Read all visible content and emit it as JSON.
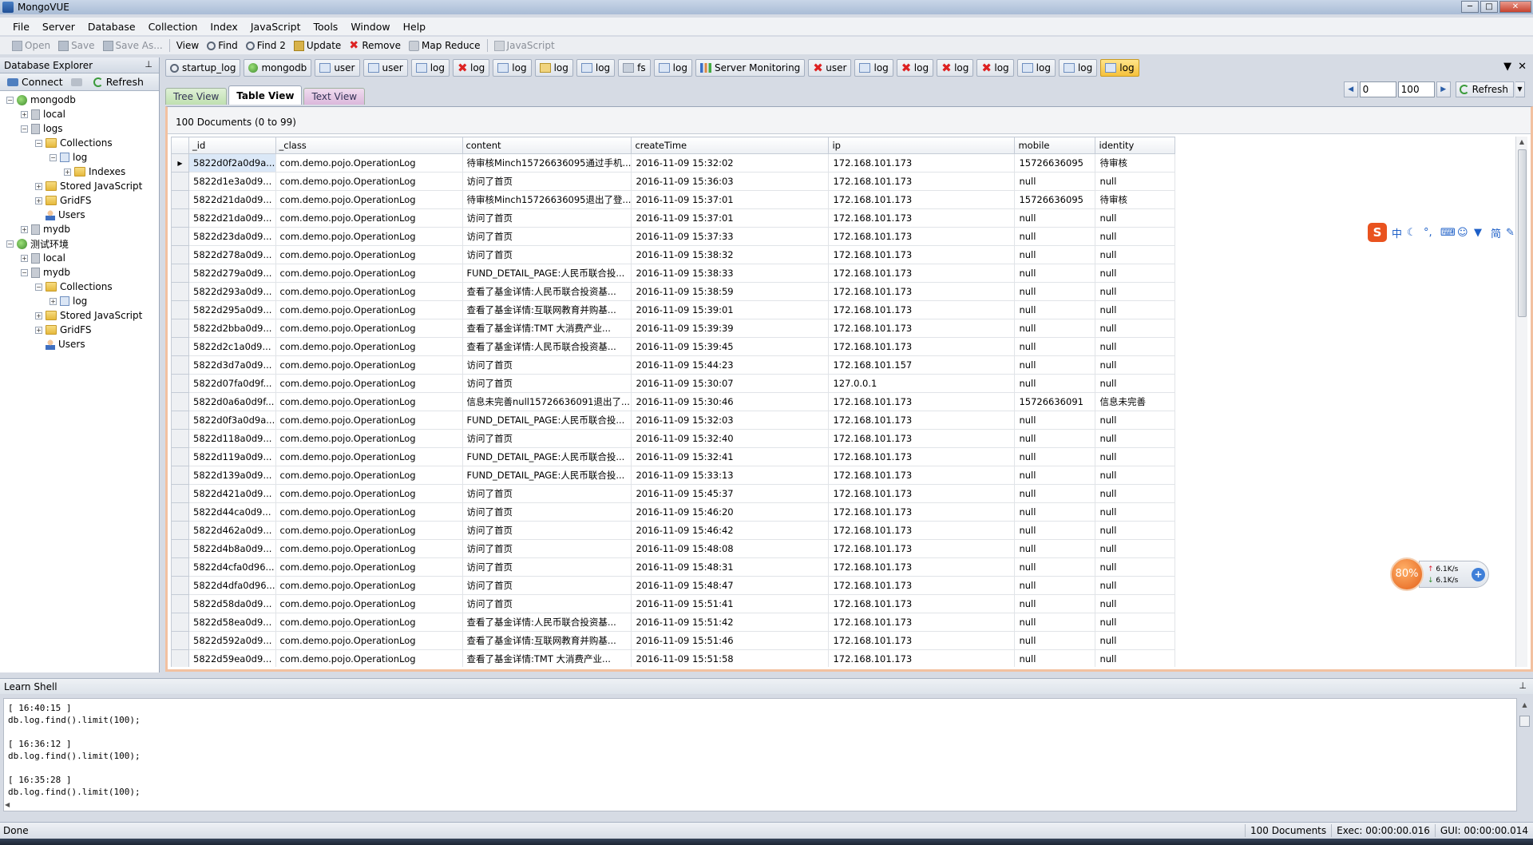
{
  "window": {
    "title": "MongoVUE",
    "min_label": "─",
    "max_label": "□",
    "close_label": "✕"
  },
  "menu": [
    "File",
    "Server",
    "Database",
    "Collection",
    "Index",
    "JavaScript",
    "Tools",
    "Window",
    "Help"
  ],
  "toolbar": {
    "open": "Open",
    "save": "Save",
    "save_as": "Save As...",
    "view": "View",
    "find": "Find",
    "find2": "Find 2",
    "update": "Update",
    "remove": "Remove",
    "map_reduce": "Map Reduce",
    "javascript": "JavaScript"
  },
  "explorer": {
    "title": "Database Explorer",
    "pin": "⊥",
    "connect": "Connect",
    "refresh": "Refresh",
    "tree": [
      {
        "label": "mongodb",
        "level": 0,
        "toggle": "−",
        "icon": "server-icon"
      },
      {
        "label": "local",
        "level": 1,
        "toggle": "+",
        "icon": "database-icon"
      },
      {
        "label": "logs",
        "level": 1,
        "toggle": "−",
        "icon": "database-icon"
      },
      {
        "label": "Collections",
        "level": 2,
        "toggle": "−",
        "icon": "folder-icon"
      },
      {
        "label": "log",
        "level": 3,
        "toggle": "−",
        "icon": "collection-icon"
      },
      {
        "label": "Indexes",
        "level": 4,
        "toggle": "+",
        "icon": "folder-icon"
      },
      {
        "label": "Stored JavaScript",
        "level": 2,
        "toggle": "+",
        "icon": "folder-icon"
      },
      {
        "label": "GridFS",
        "level": 2,
        "toggle": "+",
        "icon": "folder-icon"
      },
      {
        "label": "Users",
        "level": 2,
        "toggle": "",
        "icon": "user-icon"
      },
      {
        "label": "mydb",
        "level": 1,
        "toggle": "+",
        "icon": "database-icon"
      },
      {
        "label": "测试环境",
        "level": 0,
        "toggle": "−",
        "icon": "server-icon"
      },
      {
        "label": "local",
        "level": 1,
        "toggle": "+",
        "icon": "database-icon"
      },
      {
        "label": "mydb",
        "level": 1,
        "toggle": "−",
        "icon": "database-icon"
      },
      {
        "label": "Collections",
        "level": 2,
        "toggle": "−",
        "icon": "folder-icon"
      },
      {
        "label": "log",
        "level": 3,
        "toggle": "+",
        "icon": "collection-icon"
      },
      {
        "label": "Stored JavaScript",
        "level": 2,
        "toggle": "+",
        "icon": "folder-icon"
      },
      {
        "label": "GridFS",
        "level": 2,
        "toggle": "+",
        "icon": "folder-icon"
      },
      {
        "label": "Users",
        "level": 2,
        "toggle": "",
        "icon": "user-icon"
      }
    ]
  },
  "doc_tabs": [
    {
      "label": "startup_log",
      "icon": "find"
    },
    {
      "label": "mongodb",
      "icon": "db"
    },
    {
      "label": "user",
      "icon": "coll"
    },
    {
      "label": "user",
      "icon": "coll"
    },
    {
      "label": "log",
      "icon": "coll"
    },
    {
      "label": "log",
      "icon": "x"
    },
    {
      "label": "log",
      "icon": "coll"
    },
    {
      "label": "log",
      "icon": "edit"
    },
    {
      "label": "log",
      "icon": "coll"
    },
    {
      "label": "fs",
      "icon": "fs"
    },
    {
      "label": "log",
      "icon": "coll"
    },
    {
      "label": "Server Monitoring",
      "icon": "chart"
    },
    {
      "label": "user",
      "icon": "x"
    },
    {
      "label": "log",
      "icon": "coll"
    },
    {
      "label": "log",
      "icon": "x"
    },
    {
      "label": "log",
      "icon": "x"
    },
    {
      "label": "log",
      "icon": "x"
    },
    {
      "label": "log",
      "icon": "coll"
    },
    {
      "label": "log",
      "icon": "coll"
    },
    {
      "label": "log",
      "icon": "coll",
      "active": true
    }
  ],
  "tabs_ctrl": {
    "dropdown": "▼",
    "close": "✕"
  },
  "views": {
    "tree": "Tree View",
    "table": "Table View",
    "text": "Text View"
  },
  "pager": {
    "skip": "0",
    "limit": "100",
    "refresh": "Refresh",
    "prev": "◀",
    "next": "▶",
    "drop": "▼"
  },
  "results": {
    "count_label": "100 Documents (0 to 99)",
    "columns": [
      "_id",
      "_class",
      "content",
      "createTime",
      "ip",
      "mobile",
      "identity"
    ],
    "rows": [
      [
        "5822d0f2a0d9a...",
        "com.demo.pojo.OperationLog",
        "待审核Minch15726636095通过手机...",
        "2016-11-09 15:32:02",
        "172.168.101.173",
        "15726636095",
        "待审核"
      ],
      [
        "5822d1e3a0d9...",
        "com.demo.pojo.OperationLog",
        "访问了首页",
        "2016-11-09 15:36:03",
        "172.168.101.173",
        "null",
        "null"
      ],
      [
        "5822d21da0d9...",
        "com.demo.pojo.OperationLog",
        "待审核Minch15726636095退出了登...",
        "2016-11-09 15:37:01",
        "172.168.101.173",
        "15726636095",
        "待审核"
      ],
      [
        "5822d21da0d9...",
        "com.demo.pojo.OperationLog",
        "访问了首页",
        "2016-11-09 15:37:01",
        "172.168.101.173",
        "null",
        "null"
      ],
      [
        "5822d23da0d9...",
        "com.demo.pojo.OperationLog",
        "访问了首页",
        "2016-11-09 15:37:33",
        "172.168.101.173",
        "null",
        "null"
      ],
      [
        "5822d278a0d9...",
        "com.demo.pojo.OperationLog",
        "访问了首页",
        "2016-11-09 15:38:32",
        "172.168.101.173",
        "null",
        "null"
      ],
      [
        "5822d279a0d9...",
        "com.demo.pojo.OperationLog",
        "FUND_DETAIL_PAGE:人民币联合投...",
        "2016-11-09 15:38:33",
        "172.168.101.173",
        "null",
        "null"
      ],
      [
        "5822d293a0d9...",
        "com.demo.pojo.OperationLog",
        "查看了基金详情:人民币联合投资基...",
        "2016-11-09 15:38:59",
        "172.168.101.173",
        "null",
        "null"
      ],
      [
        "5822d295a0d9...",
        "com.demo.pojo.OperationLog",
        "查看了基金详情:互联网教育并购基...",
        "2016-11-09 15:39:01",
        "172.168.101.173",
        "null",
        "null"
      ],
      [
        "5822d2bba0d9...",
        "com.demo.pojo.OperationLog",
        "查看了基金详情:TMT 大消费产业...",
        "2016-11-09 15:39:39",
        "172.168.101.173",
        "null",
        "null"
      ],
      [
        "5822d2c1a0d9...",
        "com.demo.pojo.OperationLog",
        "查看了基金详情:人民币联合投资基...",
        "2016-11-09 15:39:45",
        "172.168.101.173",
        "null",
        "null"
      ],
      [
        "5822d3d7a0d9...",
        "com.demo.pojo.OperationLog",
        "访问了首页",
        "2016-11-09 15:44:23",
        "172.168.101.157",
        "null",
        "null"
      ],
      [
        "5822d07fa0d9f...",
        "com.demo.pojo.OperationLog",
        "访问了首页",
        "2016-11-09 15:30:07",
        "127.0.0.1",
        "null",
        "null"
      ],
      [
        "5822d0a6a0d9f...",
        "com.demo.pojo.OperationLog",
        "信息未完善null15726636091退出了...",
        "2016-11-09 15:30:46",
        "172.168.101.173",
        "15726636091",
        "信息未完善"
      ],
      [
        "5822d0f3a0d9a...",
        "com.demo.pojo.OperationLog",
        "FUND_DETAIL_PAGE:人民币联合投...",
        "2016-11-09 15:32:03",
        "172.168.101.173",
        "null",
        "null"
      ],
      [
        "5822d118a0d9...",
        "com.demo.pojo.OperationLog",
        "访问了首页",
        "2016-11-09 15:32:40",
        "172.168.101.173",
        "null",
        "null"
      ],
      [
        "5822d119a0d9...",
        "com.demo.pojo.OperationLog",
        "FUND_DETAIL_PAGE:人民币联合投...",
        "2016-11-09 15:32:41",
        "172.168.101.173",
        "null",
        "null"
      ],
      [
        "5822d139a0d9...",
        "com.demo.pojo.OperationLog",
        "FUND_DETAIL_PAGE:人民币联合投...",
        "2016-11-09 15:33:13",
        "172.168.101.173",
        "null",
        "null"
      ],
      [
        "5822d421a0d9...",
        "com.demo.pojo.OperationLog",
        "访问了首页",
        "2016-11-09 15:45:37",
        "172.168.101.173",
        "null",
        "null"
      ],
      [
        "5822d44ca0d9...",
        "com.demo.pojo.OperationLog",
        "访问了首页",
        "2016-11-09 15:46:20",
        "172.168.101.173",
        "null",
        "null"
      ],
      [
        "5822d462a0d9...",
        "com.demo.pojo.OperationLog",
        "访问了首页",
        "2016-11-09 15:46:42",
        "172.168.101.173",
        "null",
        "null"
      ],
      [
        "5822d4b8a0d9...",
        "com.demo.pojo.OperationLog",
        "访问了首页",
        "2016-11-09 15:48:08",
        "172.168.101.173",
        "null",
        "null"
      ],
      [
        "5822d4cfa0d96...",
        "com.demo.pojo.OperationLog",
        "访问了首页",
        "2016-11-09 15:48:31",
        "172.168.101.173",
        "null",
        "null"
      ],
      [
        "5822d4dfa0d96...",
        "com.demo.pojo.OperationLog",
        "访问了首页",
        "2016-11-09 15:48:47",
        "172.168.101.173",
        "null",
        "null"
      ],
      [
        "5822d58da0d9...",
        "com.demo.pojo.OperationLog",
        "访问了首页",
        "2016-11-09 15:51:41",
        "172.168.101.173",
        "null",
        "null"
      ],
      [
        "5822d58ea0d9...",
        "com.demo.pojo.OperationLog",
        "查看了基金详情:人民币联合投资基...",
        "2016-11-09 15:51:42",
        "172.168.101.173",
        "null",
        "null"
      ],
      [
        "5822d592a0d9...",
        "com.demo.pojo.OperationLog",
        "查看了基金详情:互联网教育并购基...",
        "2016-11-09 15:51:46",
        "172.168.101.173",
        "null",
        "null"
      ],
      [
        "5822d59ea0d9...",
        "com.demo.pojo.OperationLog",
        "查看了基金详情:TMT 大消费产业...",
        "2016-11-09 15:51:58",
        "172.168.101.173",
        "null",
        "null"
      ]
    ]
  },
  "shell": {
    "title": "Learn Shell",
    "entries": [
      {
        "time": "[ 16:40:15 ]",
        "cmd": "db.log.find().limit(100);"
      },
      {
        "time": "[ 16:36:12 ]",
        "cmd": "db.log.find().limit(100);"
      },
      {
        "time": "[ 16:35:28 ]",
        "cmd": "db.log.find().limit(100);"
      }
    ]
  },
  "status": {
    "left": "Done",
    "docs": "100 Documents",
    "exec": "Exec:  00:00:00.016",
    "gui": "GUI:  00:00:00.014"
  },
  "ime": {
    "logo": "S",
    "lang": "中",
    "mode": "简"
  },
  "speed": {
    "percent": "80%",
    "up": "6.1K/s",
    "down": "6.1K/s",
    "plus": "+"
  },
  "colors": {
    "active_tab": "#f6c13b",
    "content_border": "#f2c1a0",
    "speed_ball": "#e4611a",
    "ime_logo": "#e9531f"
  }
}
